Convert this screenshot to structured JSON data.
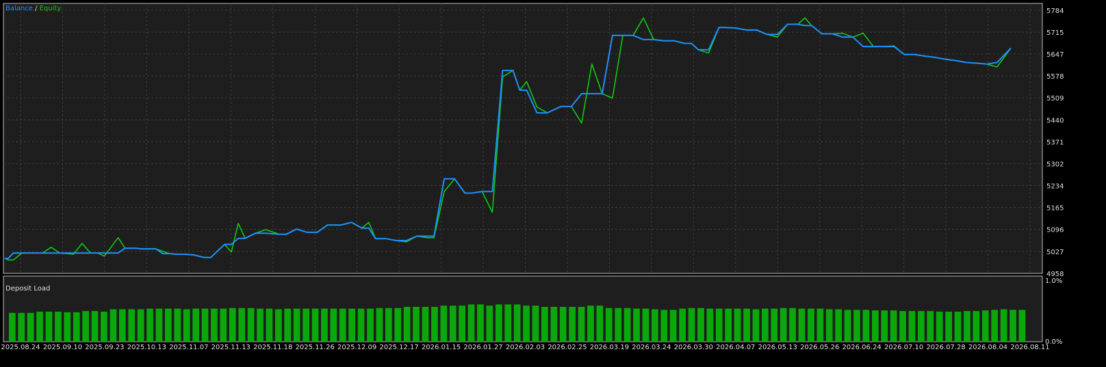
{
  "legend": {
    "balance_label": "Balance",
    "separator": " / ",
    "equity_label": "Equity"
  },
  "lower_panel_title": "Deposit Load",
  "colors": {
    "background": "#000000",
    "plot_bg": "#1e1e1e",
    "border": "#c0c0c0",
    "grid": "#3c3c3c",
    "text": "#e0e0e0",
    "balance": "#1e90ff",
    "equity": "#0fcc0f",
    "bar": "#0aa80a"
  },
  "chart_data": [
    {
      "type": "line",
      "title": "",
      "ylim": [
        4958,
        5784
      ],
      "yticks": [
        4958,
        5027,
        5096,
        5165,
        5234,
        5302,
        5371,
        5440,
        5509,
        5578,
        5647,
        5715,
        5784
      ],
      "xticks": [
        "2025.08.24",
        "2025.09.10",
        "2025.09.23",
        "2025.10.13",
        "2025.11.07",
        "2025.11.13",
        "2025.11.18",
        "2025.11.26",
        "2025.12.09",
        "2025.12.17",
        "2026.01.15",
        "2026.01.27",
        "2026.02.03",
        "2026.02.25",
        "2026.03.19",
        "2026.03.24",
        "2026.03.30",
        "2026.04.07",
        "2026.05.13",
        "2026.05.26",
        "2026.06.24",
        "2026.07.10",
        "2026.07.28",
        "2026.08.04",
        "2026.08.11"
      ],
      "x": [
        0,
        2,
        5,
        10,
        16,
        19,
        22,
        27,
        32,
        40,
        45,
        50,
        54,
        58,
        66,
        70,
        76,
        80,
        88,
        92,
        96,
        100,
        105,
        110,
        116,
        120,
        128,
        132,
        136,
        140,
        146,
        152,
        160,
        164,
        170,
        176,
        182,
        188,
        196,
        202,
        208,
        212,
        216,
        222,
        228,
        234,
        240,
        246,
        250,
        256,
        262,
        268,
        272,
        278,
        284,
        290,
        296,
        300,
        304,
        310,
        316,
        324,
        330,
        336,
        342,
        348,
        354,
        360,
        366,
        372,
        378,
        384,
        390,
        396,
        400,
        404,
        410,
        416,
        420,
        426,
        432,
        438,
        444,
        450,
        456,
        462,
        466,
        470,
        476,
        482,
        488,
        494,
        500,
        506,
        512,
        518,
        524,
        530,
        536,
        542,
        548,
        554,
        560,
        566,
        572,
        578,
        586,
        594,
        600
      ],
      "series": [
        {
          "name": "Balance",
          "values": [
            5005,
            5005,
            5022,
            5022,
            5022,
            5022,
            5022,
            5022,
            5022,
            5022,
            5022,
            5022,
            5022,
            5022,
            5022,
            5037,
            5037,
            5035,
            5035,
            5020,
            5020,
            5018,
            5018,
            5016,
            5008,
            5008,
            5049,
            5049,
            5068,
            5068,
            5084,
            5084,
            5081,
            5081,
            5097,
            5087,
            5087,
            5110,
            5110,
            5118,
            5100,
            5100,
            5067,
            5067,
            5061,
            5061,
            5075,
            5075,
            5075,
            5255,
            5255,
            5210,
            5210,
            5215,
            5215,
            5595,
            5595,
            5533,
            5533,
            5462,
            5462,
            5482,
            5482,
            5522,
            5522,
            5522,
            5705,
            5705,
            5705,
            5692,
            5692,
            5688,
            5688,
            5680,
            5680,
            5660,
            5660,
            5730,
            5730,
            5728,
            5722,
            5722,
            5708,
            5708,
            5740,
            5740,
            5736,
            5736,
            5710,
            5710,
            5700,
            5700,
            5670,
            5670,
            5670,
            5670,
            5645,
            5645,
            5640,
            5636,
            5630,
            5626,
            5620,
            5618,
            5615,
            5620,
            5665
          ],
          "color": "#1e90ff"
        },
        {
          "name": "Equity",
          "values": [
            5005,
            5000,
            5000,
            5022,
            5022,
            5022,
            5022,
            5040,
            5022,
            5018,
            5052,
            5022,
            5022,
            5012,
            5070,
            5037,
            5037,
            5035,
            5035,
            5027,
            5020,
            5018,
            5018,
            5016,
            5008,
            5008,
            5049,
            5025,
            5115,
            5068,
            5084,
            5095,
            5081,
            5081,
            5097,
            5087,
            5087,
            5110,
            5110,
            5118,
            5100,
            5118,
            5067,
            5067,
            5061,
            5057,
            5075,
            5070,
            5070,
            5215,
            5255,
            5210,
            5210,
            5215,
            5150,
            5575,
            5595,
            5533,
            5560,
            5480,
            5462,
            5482,
            5482,
            5430,
            5615,
            5522,
            5508,
            5705,
            5705,
            5760,
            5692,
            5688,
            5688,
            5680,
            5680,
            5660,
            5650,
            5730,
            5730,
            5728,
            5722,
            5722,
            5708,
            5700,
            5740,
            5740,
            5760,
            5736,
            5710,
            5710,
            5712,
            5700,
            5712,
            5670,
            5670,
            5672,
            5645,
            5645,
            5640,
            5636,
            5630,
            5626,
            5620,
            5618,
            5615,
            5606,
            5665
          ],
          "color": "#0fcc0f"
        }
      ]
    },
    {
      "type": "bar",
      "title": "Deposit Load",
      "ylim": [
        0.0,
        1.0
      ],
      "ytick_labels": [
        "1.0%",
        "0.0%"
      ],
      "values": [
        0.48,
        0.48,
        0.48,
        0.5,
        0.5,
        0.5,
        0.49,
        0.49,
        0.51,
        0.51,
        0.5,
        0.54,
        0.54,
        0.54,
        0.54,
        0.55,
        0.55,
        0.55,
        0.55,
        0.54,
        0.55,
        0.55,
        0.55,
        0.55,
        0.56,
        0.56,
        0.56,
        0.55,
        0.55,
        0.54,
        0.55,
        0.55,
        0.55,
        0.55,
        0.55,
        0.55,
        0.55,
        0.55,
        0.55,
        0.55,
        0.56,
        0.56,
        0.56,
        0.58,
        0.58,
        0.58,
        0.58,
        0.6,
        0.6,
        0.6,
        0.62,
        0.62,
        0.6,
        0.62,
        0.62,
        0.62,
        0.6,
        0.6,
        0.58,
        0.58,
        0.58,
        0.58,
        0.58,
        0.6,
        0.6,
        0.56,
        0.56,
        0.56,
        0.55,
        0.55,
        0.54,
        0.53,
        0.53,
        0.55,
        0.56,
        0.56,
        0.55,
        0.55,
        0.55,
        0.55,
        0.55,
        0.54,
        0.55,
        0.55,
        0.56,
        0.56,
        0.55,
        0.55,
        0.55,
        0.54,
        0.54,
        0.53,
        0.53,
        0.53,
        0.52,
        0.52,
        0.52,
        0.51,
        0.51,
        0.51,
        0.51,
        0.5,
        0.5,
        0.5,
        0.51,
        0.51,
        0.52,
        0.53,
        0.54,
        0.53,
        0.53
      ]
    }
  ]
}
